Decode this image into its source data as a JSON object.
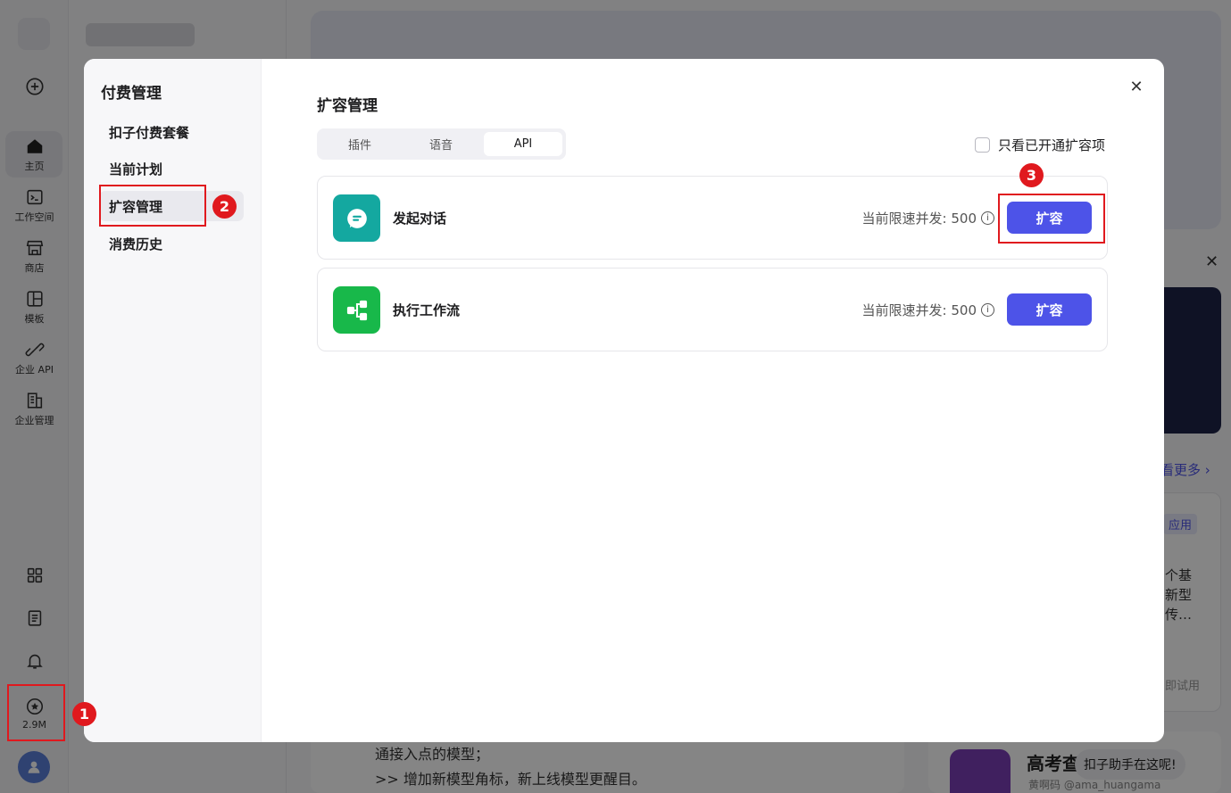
{
  "rail": {
    "items": [
      {
        "icon": "home-icon",
        "label": "主页"
      },
      {
        "icon": "workspace-icon",
        "label": "工作空间"
      },
      {
        "icon": "store-icon",
        "label": "商店"
      },
      {
        "icon": "template-icon",
        "label": "模板"
      },
      {
        "icon": "api-icon",
        "label": "企业 API"
      },
      {
        "icon": "enterprise-icon",
        "label": "企业管理"
      }
    ],
    "credits": "2.9M"
  },
  "background": {
    "news_lines": [
      "通接入点的模型；",
      ">> 增加新模型角标，新上线模型更醒目。"
    ],
    "see_more": "看更多 ›",
    "tag": "应用",
    "snippet": [
      "个基",
      "新型",
      "传…"
    ],
    "try_now": "即试用",
    "gaokao_title": "高考查",
    "gaokao_author": "黄啊码 @ama_huangama",
    "assistant_label": "扣子助手在这呢!"
  },
  "modal": {
    "title": "付费管理",
    "nav": [
      {
        "label": "扣子付费套餐",
        "active": false
      },
      {
        "label": "当前计划",
        "active": false
      },
      {
        "label": "扩容管理",
        "active": true
      },
      {
        "label": "消费历史",
        "active": false
      }
    ],
    "content_title": "扩容管理",
    "tabs": [
      {
        "label": "插件",
        "active": false
      },
      {
        "label": "语音",
        "active": false
      },
      {
        "label": "API",
        "active": true
      }
    ],
    "filter_label": "只看已开通扩容项",
    "rows": [
      {
        "name": "发起对话",
        "limit": "当前限速并发: 500",
        "button": "扩容",
        "icon": "chat-icon",
        "color": "#14a8a0"
      },
      {
        "name": "执行工作流",
        "limit": "当前限速并发: 500",
        "button": "扩容",
        "icon": "workflow-icon",
        "color": "#18b84a"
      }
    ]
  },
  "annotations": {
    "badge1": "1",
    "badge2": "2",
    "badge3": "3",
    "color": "#e0191e"
  },
  "colors": {
    "accent": "#4d53e8"
  }
}
